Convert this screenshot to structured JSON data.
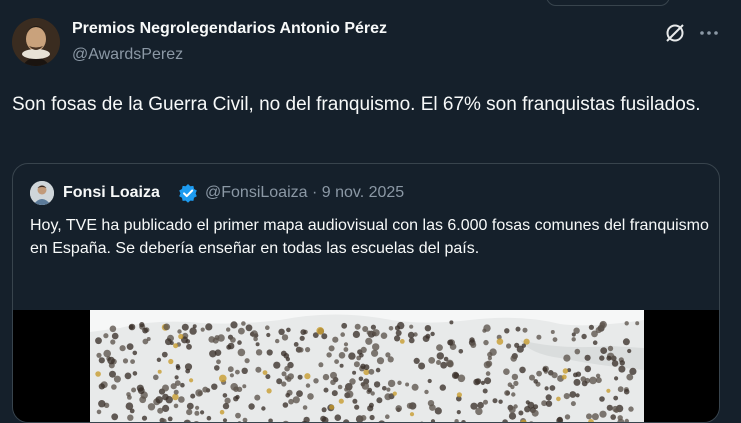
{
  "tweet": {
    "author_name": "Premios Negrolegendarios Antonio Pérez",
    "author_handle": "@AwardsPerez",
    "text": "Son fosas de la Guerra Civil, no del franquismo. El 67% son franquistas fusilados."
  },
  "quote": {
    "author_name": "Fonsi Loaiza",
    "meta": "@FonsiLoaiza · 9 nov. 2025",
    "text": "Hoy, TVE ha publicado el primer mapa audiovisual con las 6.000 fosas comunes del franquismo en España. Se debería enseñar en todas las escuelas del país.",
    "media_alt": "map-of-graves"
  },
  "icons": {
    "grok": "grok-icon",
    "more": "more-icon",
    "verified": "verified-badge-icon"
  },
  "colors": {
    "background": "#15202b",
    "text": "#f7f9f9",
    "secondary": "#8b98a5",
    "border": "#38444d",
    "verified": "#1d9bf0"
  }
}
